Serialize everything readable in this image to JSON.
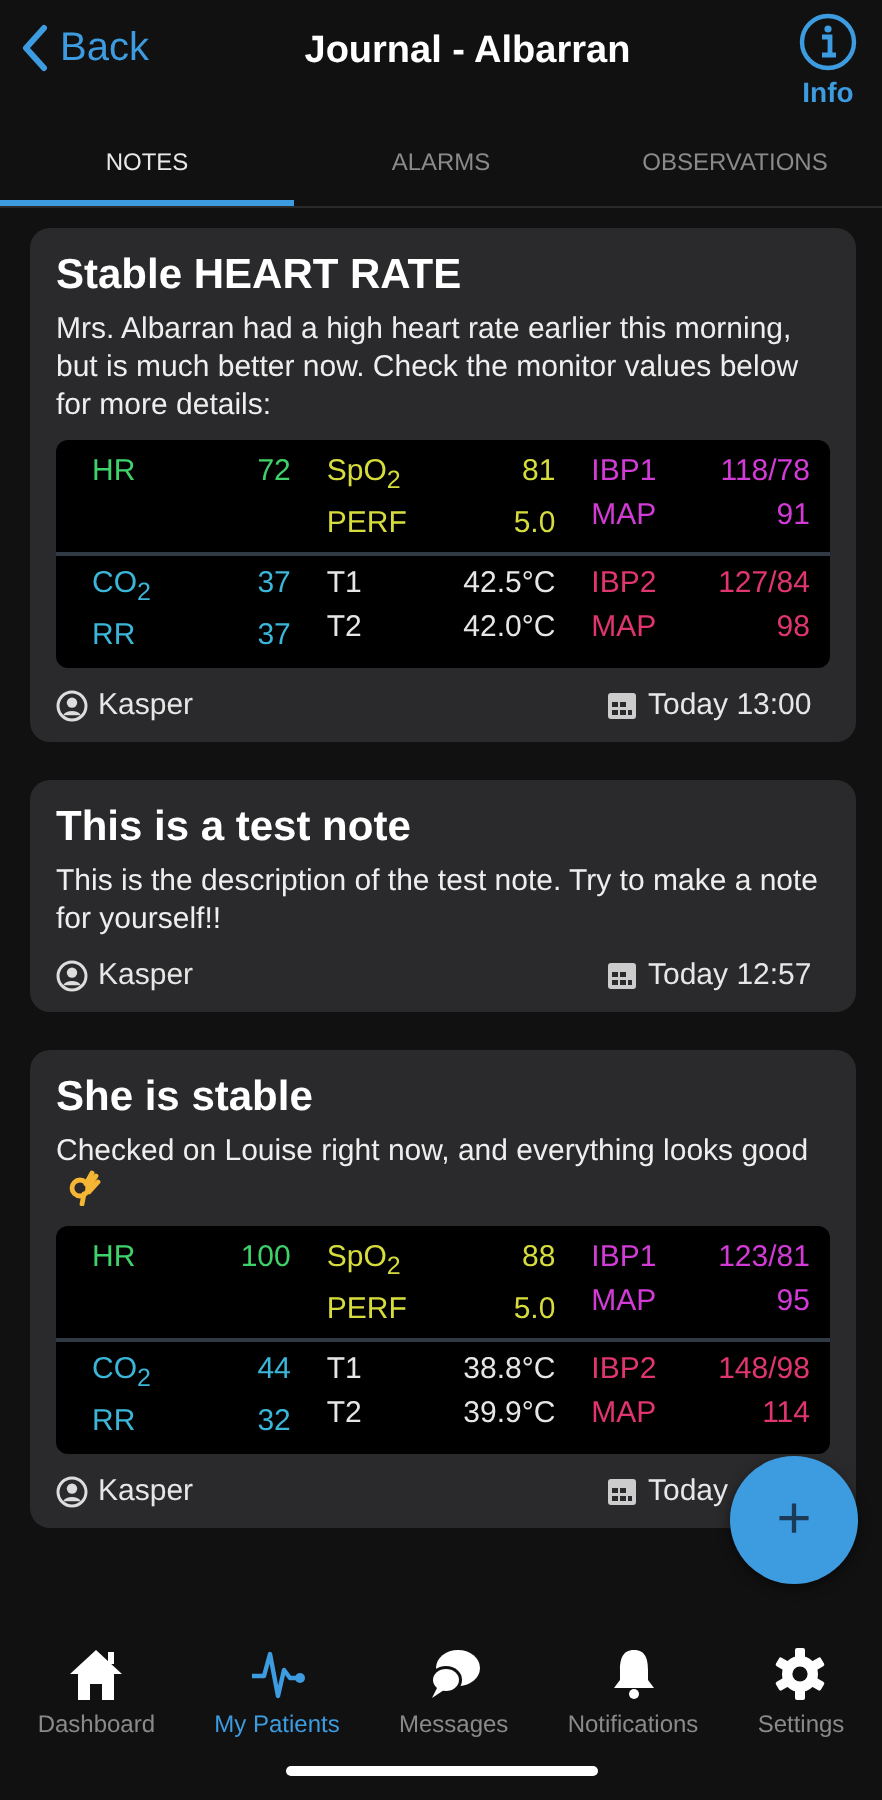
{
  "header": {
    "back": "Back",
    "title": "Journal - Albarran",
    "info": "Info"
  },
  "tabs": [
    {
      "label": "NOTES",
      "selected": true
    },
    {
      "label": "ALARMS",
      "selected": false
    },
    {
      "label": "OBSERVATIONS",
      "selected": false
    }
  ],
  "notes": [
    {
      "title": "Stable HEART RATE",
      "text": "Mrs. Albarran had a high heart rate earlier this morning, but is much better now. Check the monitor values below for more details:",
      "monitor": [
        [
          [
            {
              "label": "HR",
              "value": "72",
              "color": "#3fd26a"
            }
          ],
          [
            {
              "label": "SpO$_{2}$",
              "value": "81",
              "color": "#d6dc3c"
            },
            {
              "label": "PERF",
              "value": "5.0",
              "color": "#d6dc3c"
            }
          ],
          [
            {
              "label": "IBP1",
              "value": "118/78",
              "color": "#d23bd6"
            },
            {
              "label": "MAP",
              "value": "91",
              "color": "#d23bd6"
            }
          ]
        ],
        [
          [
            {
              "label": "CO$_{2}$",
              "value": "37",
              "color": "#3bb6d8"
            },
            {
              "label": "RR",
              "value": "37",
              "color": "#3bb6d8"
            }
          ],
          [
            {
              "label": "T1",
              "value": "42.5°C",
              "color": "#e6e6e6"
            },
            {
              "label": "T2",
              "value": "42.0°C",
              "color": "#e6e6e6"
            }
          ],
          [
            {
              "label": "IBP2",
              "value": "127/84",
              "color": "#e0356f"
            },
            {
              "label": "MAP",
              "value": "98",
              "color": "#e0356f"
            }
          ]
        ]
      ],
      "author": "Kasper",
      "date": "Today 13:00"
    },
    {
      "title": "This is a test note",
      "text": "This is the description of the test note. Try to make a note for yourself!!",
      "author": "Kasper",
      "date": "Today 12:57"
    },
    {
      "title": "She is stable",
      "text": "Checked on Louise right now, and everything looks good",
      "kind": "emoji",
      "monitor": [
        [
          [
            {
              "label": "HR",
              "value": "100",
              "color": "#3fd26a"
            }
          ],
          [
            {
              "label": "SpO$_{2}$",
              "value": "88",
              "color": "#d6dc3c"
            },
            {
              "label": "PERF",
              "value": "5.0",
              "color": "#d6dc3c"
            }
          ],
          [
            {
              "label": "IBP1",
              "value": "123/81",
              "color": "#d23bd6"
            },
            {
              "label": "MAP",
              "value": "95",
              "color": "#d23bd6"
            }
          ]
        ],
        [
          [
            {
              "label": "CO$_{2}$",
              "value": "44",
              "color": "#3bb6d8"
            },
            {
              "label": "RR",
              "value": "32",
              "color": "#3bb6d8"
            }
          ],
          [
            {
              "label": "T1",
              "value": "38.8°C",
              "color": "#e6e6e6"
            },
            {
              "label": "T2",
              "value": "39.9°C",
              "color": "#e6e6e6"
            }
          ],
          [
            {
              "label": "IBP2",
              "value": "148/98",
              "color": "#e0356f"
            },
            {
              "label": "MAP",
              "value": "114",
              "color": "#e0356f"
            }
          ]
        ]
      ],
      "author": "Kasper",
      "date": "Today"
    }
  ],
  "fab": "+",
  "nav": [
    {
      "label": "Dashboard",
      "selected": false
    },
    {
      "label": "My Patients",
      "selected": true
    },
    {
      "label": "Messages",
      "selected": false
    },
    {
      "label": "Notifications",
      "selected": false
    },
    {
      "label": "Settings",
      "selected": false
    }
  ]
}
